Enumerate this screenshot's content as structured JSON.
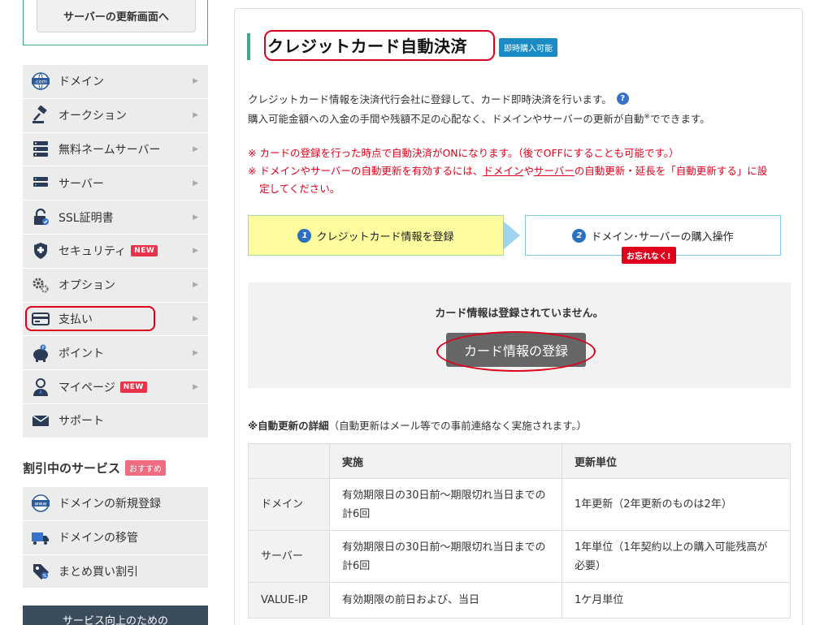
{
  "sidebar": {
    "update_button": "サーバーの更新画面へ",
    "menu": [
      {
        "label": "ドメイン",
        "icon": "dotcom-icon"
      },
      {
        "label": "オークション",
        "icon": "gavel-icon"
      },
      {
        "label": "無料ネームサーバー",
        "icon": "server-stack-icon"
      },
      {
        "label": "サーバー",
        "icon": "server-icon"
      },
      {
        "label": "SSL証明書",
        "icon": "ssl-lock-icon"
      },
      {
        "label": "セキュリティ",
        "icon": "shield-icon",
        "badge": "NEW"
      },
      {
        "label": "オプション",
        "icon": "gears-icon"
      },
      {
        "label": "支払い",
        "icon": "card-icon"
      },
      {
        "label": "ポイント",
        "icon": "piggy-bank-icon"
      },
      {
        "label": "マイページ",
        "icon": "user-icon",
        "badge": "NEW"
      },
      {
        "label": "サポート",
        "icon": "mail-icon"
      }
    ],
    "discount_title": "割引中のサービス",
    "discount_badge": "おすすめ",
    "discount_menu": [
      {
        "label": "ドメインの新規登録",
        "icon": "www-icon"
      },
      {
        "label": "ドメインの移管",
        "icon": "truck-icon"
      },
      {
        "label": "まとめ買い割引",
        "icon": "tag-icon"
      }
    ],
    "survey_label": "サービス向上のための"
  },
  "main": {
    "title": "クレジットカード自動決済",
    "instant_badge": "即時購入可能",
    "desc1": "クレジットカード情報を決済代行会社に登録して、カード即時決済を行います。",
    "desc2_a": "購入可能金額への入金の手間や残額不足の心配なく、ドメインやサーバーの更新が自動",
    "desc2_sup": "※",
    "desc2_b": "でできます。",
    "note1": "※ カードの登録を行った時点で自動決済がONになります。（後でOFFにすることも可能です。）",
    "note2_a": "※ ドメインやサーバーの自動更新を有効するには、",
    "note2_link1": "ドメイン",
    "note2_mid": "や",
    "note2_link2": "サーバー",
    "note2_b": "の自動更新・延長を「自動更新する」に設",
    "note2_c": "定してください。",
    "step1_num": "1",
    "step1_label": "クレジットカード情報を登録",
    "step2_num": "2",
    "step2_label": "ドメイン･サーバーの購入操作",
    "forget_badge": "お忘れなく!",
    "card_msg": "カード情報は登録されていません。",
    "card_button": "カード情報の登録",
    "detail_title_bold": "※自動更新の詳細",
    "detail_title_rest": "（自動更新はメール等での事前連絡なく実施されます。）",
    "table": {
      "headers": [
        "",
        "実施",
        "更新単位"
      ],
      "rows": [
        [
          "ドメイン",
          "有効期限日の30日前～期限切れ当日までの計6回",
          "1年更新（2年更新のものは2年）"
        ],
        [
          "サーバー",
          "有効期限日の30日前～期限切れ当日までの計6回",
          "1年単位（1年契約以上の購入可能残高が必要）"
        ],
        [
          "VALUE-IP",
          "有効期限の前日および、当日",
          "1ケ月単位"
        ]
      ]
    }
  },
  "colors": {
    "accent_green": "#3aaa8a",
    "annotation_red": "#e0001b",
    "badge_blue": "#1a8bc4",
    "new_badge": "#e8334a"
  }
}
